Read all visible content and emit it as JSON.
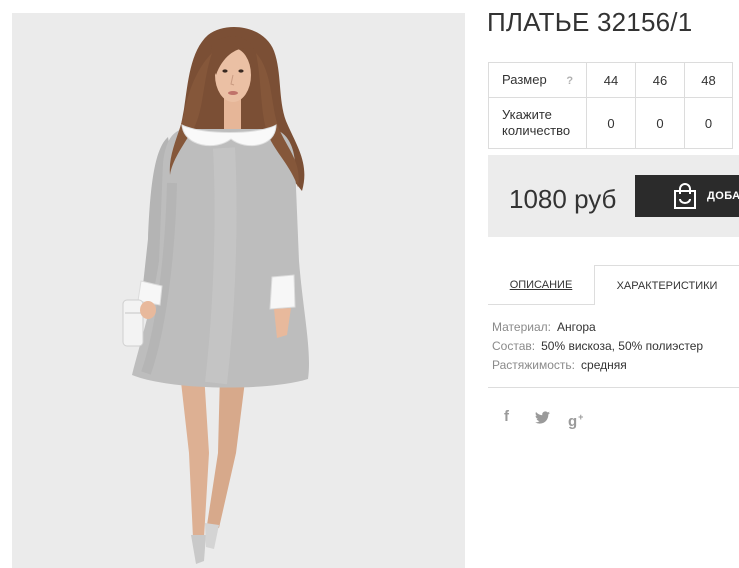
{
  "colors": {
    "text": "#333333",
    "muted": "#8a8a8a",
    "border": "#dddddd",
    "price_bg": "#ececec",
    "button_bg": "#2b2b2b",
    "button_text": "#ffffff",
    "icon": "#9a9a9a"
  },
  "product": {
    "title": "ПЛАТЬЕ 32156/1"
  },
  "size_table": {
    "size_label": "Размер",
    "size_help": "?",
    "sizes": [
      "44",
      "46",
      "48"
    ],
    "quantity_label": "Укажите количество",
    "quantities": [
      "0",
      "0",
      "0"
    ]
  },
  "purchase": {
    "price": "1080 руб",
    "add_to_cart_icon": "shopping-bag-icon",
    "add_to_cart_label": "ДОБА"
  },
  "tabs": [
    {
      "label": "ОПИСАНИЕ",
      "active": false
    },
    {
      "label": "ХАРАКТЕРИСТИКИ",
      "active": true
    }
  ],
  "characteristics": [
    {
      "label": "Материал:",
      "value": "Ангора"
    },
    {
      "label": "Состав:",
      "value": "50% вискоза, 50% полиэстер"
    },
    {
      "label": "Растяжимость:",
      "value": "средняя"
    }
  ],
  "share": [
    {
      "icon": "facebook-icon",
      "glyph": "f"
    },
    {
      "icon": "twitter-icon"
    },
    {
      "icon": "google-plus-icon",
      "glyph": "g",
      "glyph_sup": "+"
    }
  ]
}
